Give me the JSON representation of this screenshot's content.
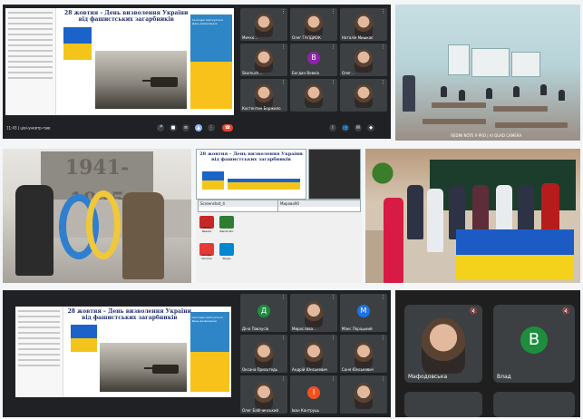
{
  "slide": {
    "title_line1": "28 жовтня – День визволення України",
    "title_line2": "від фашистських загарбників",
    "poster_top": "Сьогодні святкується День визволення"
  },
  "meet1": {
    "time_text": "11:43 | ціві-уневтр-таю",
    "tiles": [
      {
        "name": "Мичко…",
        "kind": "face"
      },
      {
        "name": "Олег ГАЛДИОК",
        "kind": "face"
      },
      {
        "name": "Наталія Мишкає",
        "kind": "face"
      },
      {
        "name": "Skumuch…",
        "kind": "face"
      },
      {
        "name": "Богдан Вовків",
        "kind": "avatar",
        "letter": "B",
        "color": "#8e24aa"
      },
      {
        "name": "Олег…",
        "kind": "face"
      },
      {
        "name": "Костянтин Боржило",
        "kind": "face"
      },
      {
        "name": "",
        "kind": "face"
      },
      {
        "name": "",
        "kind": "face"
      }
    ]
  },
  "classroom": {
    "stamp": "REDMI NOTE 9 PRO | AI QUAD CAMERA"
  },
  "memorial": {
    "years": "1941-1945"
  },
  "desktop": {
    "title_line1": "28 жовтня – День визволення України",
    "title_line2": "від фашистських загарбників",
    "win_label": "Screenshot_4",
    "paint_label": "Мирова90",
    "icons": [
      {
        "label": "Adobe Reader",
        "color": "#c62828"
      },
      {
        "label": "Bandicam",
        "color": "#2e7d32"
      },
      {
        "label": "Google Chrome",
        "color": "#e53935"
      },
      {
        "label": "Skype",
        "color": "#0288d1"
      }
    ]
  },
  "meet2": {
    "time_text": "",
    "tiles": [
      {
        "name": "Діна Павлусів",
        "kind": "avatar",
        "letter": "Д",
        "color": "#1e8e3e"
      },
      {
        "name": "Мирослава…",
        "kind": "face"
      },
      {
        "name": "Макс Поріцький",
        "kind": "avatar",
        "letter": "M",
        "color": "#1a73e8"
      },
      {
        "name": "Оксана Присьтедь",
        "kind": "face"
      },
      {
        "name": "Андрій Юнськевич",
        "kind": "face"
      },
      {
        "name": "Соня Юнськевич",
        "kind": "face"
      },
      {
        "name": "Олег Бабічинський",
        "kind": "face"
      },
      {
        "name": "Іван Кантруць",
        "kind": "avatar",
        "letter": "I",
        "color": "#f4511e"
      },
      {
        "name": "",
        "kind": "face"
      }
    ]
  },
  "mobile": {
    "status": "",
    "tiles": [
      {
        "name": "Мафодовська",
        "kind": "face"
      },
      {
        "name": "Влад",
        "kind": "avatar",
        "letter": "B"
      }
    ]
  },
  "colors": {
    "meet_bg": "#202124",
    "tile_bg": "#3c4043",
    "ua_blue": "#1d5bc4",
    "ua_yellow": "#f4d21b"
  }
}
